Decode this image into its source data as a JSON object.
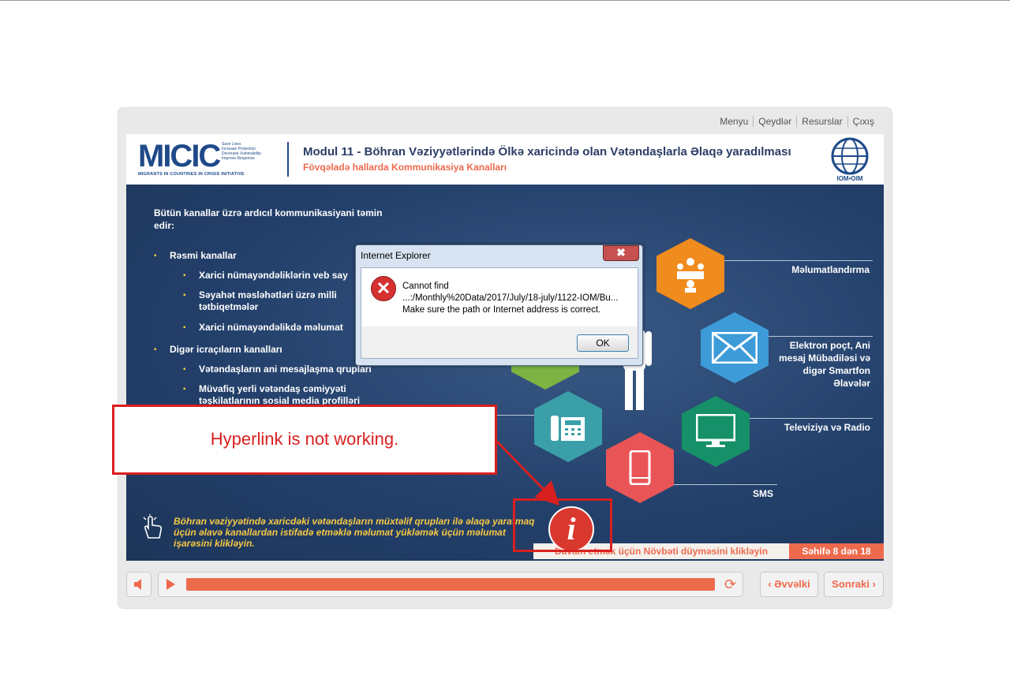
{
  "menu": [
    "Menyu",
    "Qeydlər",
    "Resurslar",
    "Çıxış"
  ],
  "logo": {
    "name": "MICIC",
    "tagline": "Save Lives\nIncrease Protection\nDecrease Vulnerability\nImprove Response",
    "subtitle": "MIGRANTS IN COUNTRIES IN CRISIS INITIATIVE",
    "iom_text": "IOM•OIM"
  },
  "header": {
    "title": "Modul 11 - Böhran Vəziyyətlərində Ölkə xaricində olan Vətəndaşlarla Əlaqə yaradılması",
    "subtitle": "Fövqəladə hallarda Kommunikasiya Kanalları"
  },
  "content": {
    "intro": "Bütün kanallar üzrə ardıcıl kommunikasiyani təmin edir:",
    "items": [
      {
        "level": 1,
        "text": "Rəsmi kanallar"
      },
      {
        "level": 2,
        "text": "Xarici nümayəndəliklərin veb say"
      },
      {
        "level": 2,
        "text": "Səyahət məsləhətləri üzrə milli"
      },
      {
        "level": 2,
        "text": "tətbiqetmələr"
      },
      {
        "level": 2,
        "text": "Xarici nümayəndəlikdə məlumat"
      },
      {
        "level": 1,
        "text": "Digər icraçıların kanalları"
      },
      {
        "level": 2,
        "text": "Vətəndaşların ani mesajlaşma qrupları"
      },
      {
        "level": 2,
        "text": "Müvafiq yerli vətəndaş cəmiyyəti"
      },
      {
        "level": 2,
        "text": "təşkilatlarının sosial media profilləri"
      }
    ],
    "channels": [
      {
        "label": "Məlumatlandırma",
        "icon": "meeting-icon",
        "color": "#f08b1d"
      },
      {
        "label": "Elektron poçt, Ani mesaj Mübadiləsi və digər Smartfon Əlavələr",
        "icon": "envelope-icon",
        "color": "#3d9bd8"
      },
      {
        "label": "Televiziya və Radio",
        "icon": "monitor-icon",
        "color": "#159068"
      },
      {
        "label": "SMS",
        "icon": "mobile-icon",
        "color": "#e95557"
      }
    ],
    "hint": "Böhran vəziyyətində xaricdəki vətəndaşların müxtəlif qrupları ilə əlaqə yaratmaq üçün əlavə kanallardan istifadə etməklə məlumat yükləmək üçün məlumat işarəsini klikləyin.",
    "continue_text": "Davam etmək üçün Növbəti düyməsini klikləyin",
    "page_text": "Səhifə 8 dən 18",
    "info_glyph": "i"
  },
  "controls": {
    "prev_label": "Əvvəlki",
    "next_label": "Sonraki",
    "progress": 1.0
  },
  "dialog": {
    "title": "Internet Explorer",
    "close_glyph": "✖",
    "line1": "Cannot find",
    "line2": "...:/Monthly%20Data/2017/July/18-july/1122-IOM/Bu...",
    "line3": "Make sure the path or Internet address is correct.",
    "ok_label": "OK"
  },
  "annotation": {
    "text": "Hyperlink is not working.",
    "color": "#d91f1f"
  }
}
